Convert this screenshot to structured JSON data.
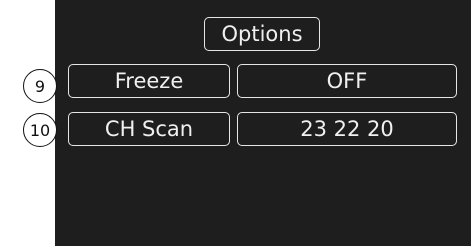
{
  "panel": {
    "title": "Options"
  },
  "rows": [
    {
      "number": "9",
      "label": "Freeze",
      "value": "OFF"
    },
    {
      "number": "10",
      "label": "CH Scan",
      "value": "23 22 20"
    }
  ],
  "colors": {
    "screen_background": "#1e1e1e",
    "text": "#f0f0f0",
    "border": "#e6e6e6",
    "badge_background": "#ffffff",
    "badge_text": "#111111"
  }
}
